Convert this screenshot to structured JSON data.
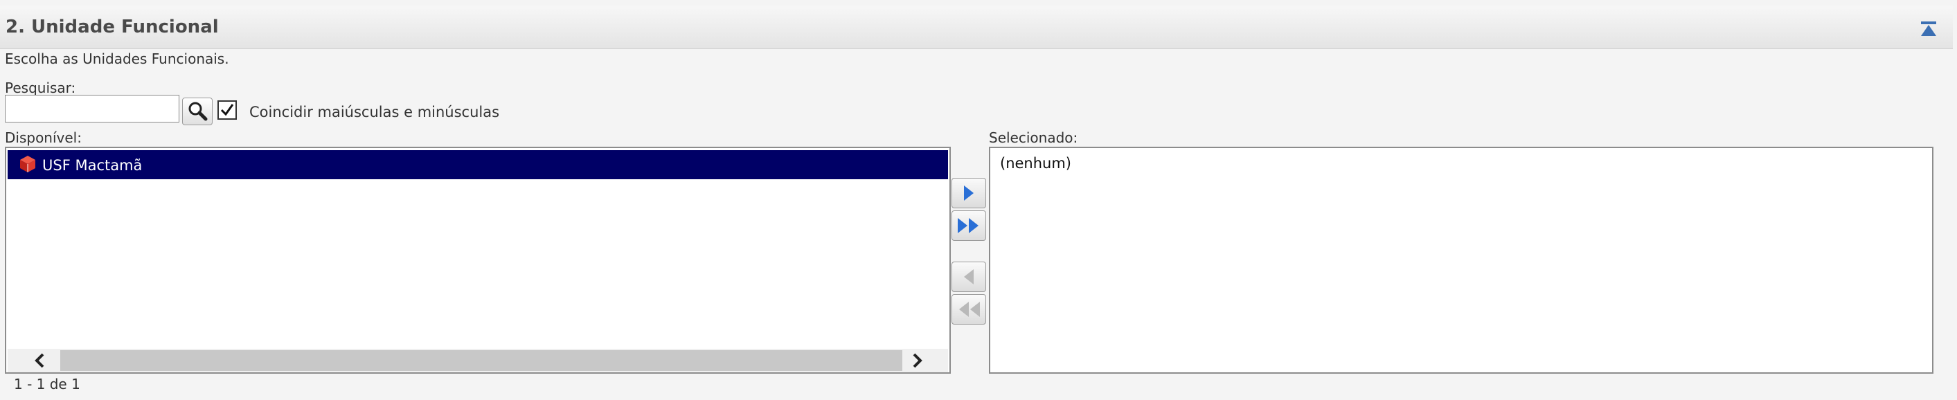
{
  "section": {
    "title": "2. Unidade Funcional",
    "collapse_icon": "collapse-up-icon"
  },
  "instructions": "Escolha as Unidades Funcionais.",
  "search": {
    "label": "Pesquisar:",
    "value": "",
    "placeholder": "",
    "button_icon": "magnifier-icon",
    "match_case": {
      "label": "Coincidir maiúsculas e minúsculas",
      "checked": true
    }
  },
  "available": {
    "label": "Disponível:",
    "items": [
      {
        "label": "USF Mactamã",
        "icon": "unit-cube-icon",
        "selected": true
      }
    ]
  },
  "selected": {
    "label": "Selecionado:",
    "empty_text": "(nenhum)"
  },
  "transfer_buttons": [
    {
      "name": "move-right-button",
      "icon": "arrow-right-icon",
      "enabled": true
    },
    {
      "name": "move-all-right-button",
      "icon": "double-arrow-right-icon",
      "enabled": true
    },
    {
      "name": "move-left-button",
      "icon": "arrow-left-icon",
      "enabled": false
    },
    {
      "name": "move-all-left-button",
      "icon": "double-arrow-left-icon",
      "enabled": false
    }
  ],
  "pagination": "1 - 1 de 1",
  "colors": {
    "selected_row_bg": "#000066",
    "arrow_enabled": "#2a6fd6",
    "arrow_disabled": "#b9b9b9"
  }
}
